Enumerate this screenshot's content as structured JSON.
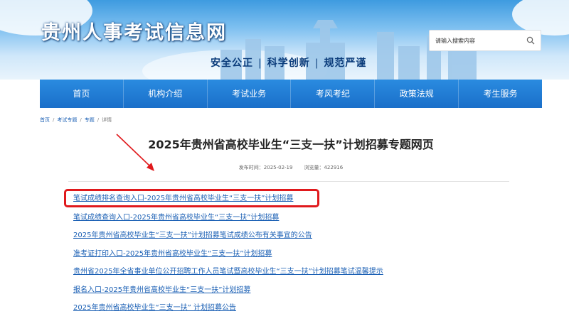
{
  "header": {
    "site_title": "贵州人事考试信息网",
    "slogan": [
      "安全公正",
      "科学创新",
      "规范严谨"
    ],
    "slogan_separator": "|",
    "search": {
      "placeholder": "请输入搜索内容",
      "icon": "search-icon"
    }
  },
  "nav": {
    "items": [
      {
        "label": "首页"
      },
      {
        "label": "机构介绍"
      },
      {
        "label": "考试业务"
      },
      {
        "label": "考风考纪"
      },
      {
        "label": "政策法规"
      },
      {
        "label": "考生服务"
      }
    ]
  },
  "breadcrumb": {
    "items": [
      "首页",
      "考试专题",
      "专题"
    ],
    "current": "详情",
    "separator": "/"
  },
  "article": {
    "title": "2025年贵州省高校毕业生“三支一扶”计划招募专题网页",
    "publish_time": "发布时间：2025-02-19",
    "views": "浏览量：422916",
    "links": [
      "笔试成绩排名查询入口-2025年贵州省高校毕业生“三支一扶”计划招募",
      "笔试成绩查询入口-2025年贵州省高校毕业生“三支一扶”计划招募",
      "2025年贵州省高校毕业生“三支一扶”计划招募笔试成绩公布有关事宜的公告",
      "准考证打印入口-2025年贵州省高校毕业生“三支一扶”计划招募",
      "贵州省2025年全省事业单位公开招聘工作人员笔试暨高校毕业生“三支一扶”计划招募笔试温馨提示",
      "报名入口-2025年贵州省高校毕业生“三支一扶”计划招募",
      "2025年贵州省高校毕业生“三支一扶” 计划招募公告"
    ]
  },
  "annotation": {
    "highlight_color": "#e0191c"
  },
  "colors": {
    "nav_bg": "#1a6fc9",
    "link": "#1a5fb4"
  }
}
